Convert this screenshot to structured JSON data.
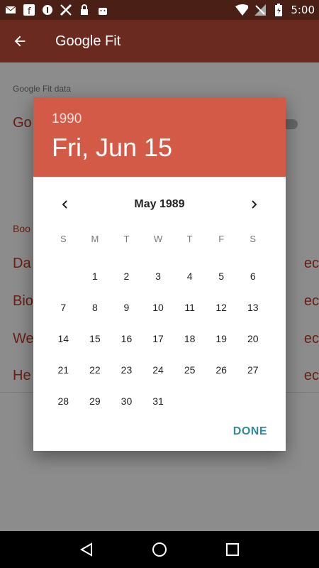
{
  "status_bar": {
    "time": "5:00",
    "left_icons": [
      "mail-icon",
      "facebook-icon",
      "info-icon",
      "tools-icon",
      "lock-icon",
      "android-icon"
    ],
    "right_icons": [
      "wifi-icon",
      "no-signal-icon",
      "battery-icon"
    ]
  },
  "app_bar": {
    "title": "Google Fit"
  },
  "background": {
    "section_header": "Google Fit data",
    "first_row": "Go",
    "section_label": "Boo",
    "rows": [
      "Da",
      "Bio",
      "We",
      "He"
    ],
    "row_suffix": "ec"
  },
  "dialog": {
    "header_year": "1990",
    "header_date": "Fri, Jun 15",
    "month_label": "May 1989",
    "weekdays": [
      "S",
      "M",
      "T",
      "W",
      "T",
      "F",
      "S"
    ],
    "weeks": [
      [
        "",
        "1",
        "2",
        "3",
        "4",
        "5",
        "6"
      ],
      [
        "7",
        "8",
        "9",
        "10",
        "11",
        "12",
        "13"
      ],
      [
        "14",
        "15",
        "16",
        "17",
        "18",
        "19",
        "20"
      ],
      [
        "21",
        "22",
        "23",
        "24",
        "25",
        "26",
        "27"
      ],
      [
        "28",
        "29",
        "30",
        "31",
        "",
        "",
        ""
      ]
    ],
    "done_label": "DONE"
  },
  "colors": {
    "header": "#d25a47",
    "accent": "#2e8b9a",
    "app_bar": "#6b2a1f"
  }
}
